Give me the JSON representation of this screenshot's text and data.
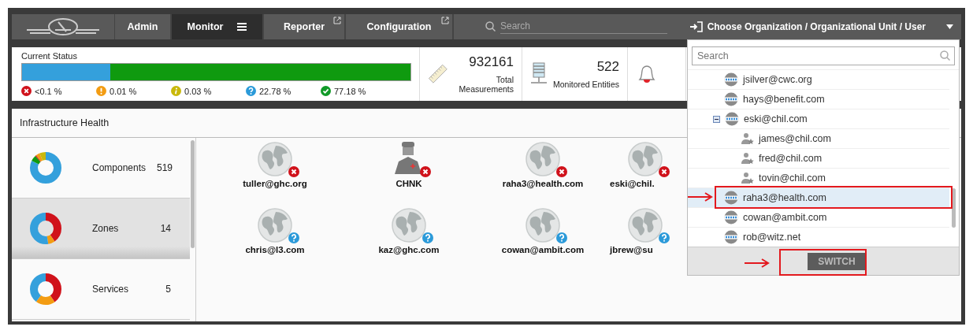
{
  "nav": {
    "tabs": [
      {
        "label": "Admin",
        "selected": false,
        "external": false,
        "menu": false
      },
      {
        "label": "Monitor",
        "selected": true,
        "external": false,
        "menu": true
      },
      {
        "label": "Reporter",
        "selected": false,
        "external": true,
        "menu": false
      },
      {
        "label": "Configuration",
        "selected": false,
        "external": true,
        "menu": false
      }
    ],
    "search": {
      "placeholder": "Search"
    },
    "org_chooser": {
      "label": "Choose Organization / Organizational Unit / User",
      "expanded": true
    }
  },
  "current_status": {
    "title": "Current Status",
    "segments": [
      {
        "color": "#34a0dc",
        "level": 0.2278
      },
      {
        "color": "#0f9a0f",
        "level": 0.7718
      }
    ],
    "legend": [
      {
        "kind": "critical",
        "text": "<0.1 %"
      },
      {
        "kind": "major",
        "text": "0.01 %"
      },
      {
        "kind": "minor",
        "text": "0.03 %"
      },
      {
        "kind": "unknown",
        "text": "22.78 %"
      },
      {
        "kind": "normal",
        "text": "77.18 %"
      }
    ]
  },
  "metrics": [
    {
      "kind": "measurements",
      "value": "932161",
      "label": "Total Measurements"
    },
    {
      "kind": "entities",
      "value": "522",
      "label": "Monitored Entities"
    },
    {
      "kind": "alarms"
    }
  ],
  "infrastructure": {
    "title": "Infrastructure Health",
    "sidebar": [
      {
        "label": "Components",
        "count": "519",
        "selected": false
      },
      {
        "label": "Zones",
        "count": "14",
        "selected": true
      },
      {
        "label": "Services",
        "count": "5",
        "selected": false
      }
    ],
    "tiles": [
      {
        "name": "tuller@ghc.org",
        "kind": "zone-critical"
      },
      {
        "name": "CHNK",
        "kind": "user-critical"
      },
      {
        "name": "raha3@health.com",
        "kind": "zone-critical"
      },
      {
        "name": "eski@chil.",
        "kind": "zone-critical"
      },
      {
        "name": "chris@l3.com",
        "kind": "zone-unknown"
      },
      {
        "name": "kaz@ghc.com",
        "kind": "zone-unknown"
      },
      {
        "name": "cowan@ambit.com",
        "kind": "zone-unknown"
      },
      {
        "name": "jbrew@su",
        "kind": "zone-unknown"
      }
    ]
  },
  "org_dropdown": {
    "search": {
      "placeholder": "Search"
    },
    "tree": [
      {
        "label": "jsilver@cwc.org",
        "selected": false
      },
      {
        "label": "hays@benefit.com",
        "selected": false
      },
      {
        "label": "eski@chil.com",
        "selected": false,
        "expanded": true,
        "children": [
          {
            "label": "james@chil.com",
            "selected": false
          },
          {
            "label": "fred@chil.com",
            "selected": false
          },
          {
            "label": "tovin@chil.com",
            "selected": false
          }
        ]
      },
      {
        "label": "raha3@health.com",
        "selected": true,
        "highlighted": true
      },
      {
        "label": "cowan@ambit.com",
        "selected": false
      },
      {
        "label": "rob@witz.net",
        "selected": false
      }
    ],
    "button": {
      "label": "SWITCH",
      "highlighted": true
    }
  }
}
